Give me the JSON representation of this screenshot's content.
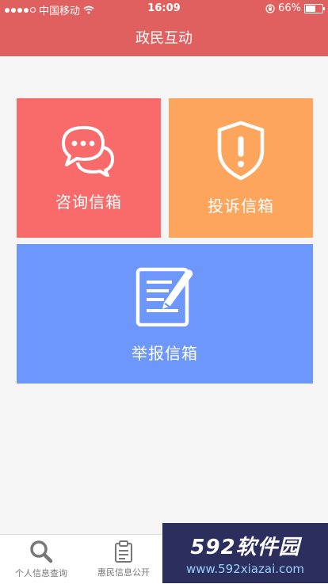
{
  "status": {
    "carrier": "中国移动",
    "time": "16:09",
    "battery_text": "66%",
    "battery_level": 0.66
  },
  "nav": {
    "title": "政民互动"
  },
  "tiles": [
    {
      "label": "咨询信箱",
      "icon": "chat-bubbles-icon",
      "color": "#f96a6a"
    },
    {
      "label": "投诉信箱",
      "icon": "shield-alert-icon",
      "color": "#fda55c"
    },
    {
      "label": "举报信箱",
      "icon": "document-edit-icon",
      "color": "#6d97fb"
    }
  ],
  "tabs": [
    {
      "label": "个人信息查询",
      "icon": "search-icon"
    },
    {
      "label": "惠民信息公开",
      "icon": "clipboard-icon"
    }
  ],
  "watermark": {
    "title": "592软件园",
    "url": "www.592xiazai.com"
  },
  "colors": {
    "header": "#e06060",
    "background": "#f5f5f5"
  }
}
